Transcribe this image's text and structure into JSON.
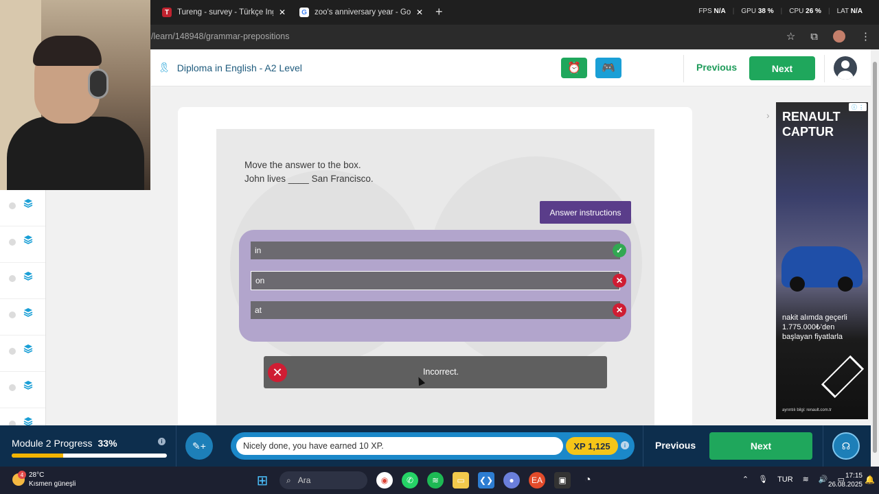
{
  "browser": {
    "tabs": [
      {
        "title": "Tureng - survey - Türkçe İngilizce",
        "favicon": "T",
        "favicon_color": "#c0232f"
      },
      {
        "title": "zoo's anniversary year - Google",
        "favicon": "G",
        "favicon_color": "#4285f4"
      }
    ],
    "url": "/learn/148948/grammar-prepositions",
    "stats": {
      "fps_label": "FPS",
      "fps": "N/A",
      "gpu_label": "GPU",
      "gpu": "38 %",
      "cpu_label": "CPU",
      "cpu": "26 %",
      "lat_label": "LAT",
      "lat": "N/A"
    }
  },
  "header": {
    "course_title": "Diploma in English - A2 Level",
    "previous_label": "Previous",
    "next_label": "Next",
    "accent": "#1fa75c",
    "alarm_color": "#1fa75c",
    "game_color": "#1a9fd6"
  },
  "exercise": {
    "instruction": "Move the answer to the box.",
    "sentence": "John lives ____ San Francisco.",
    "answer_instructions_label": "Answer instructions",
    "options": [
      {
        "label": "in",
        "status": "correct",
        "selected": false
      },
      {
        "label": "on",
        "status": "incorrect",
        "selected": true
      },
      {
        "label": "at",
        "status": "incorrect",
        "selected": false
      }
    ],
    "feedback": "Incorrect."
  },
  "ad": {
    "brand_line1": "RENAULT",
    "brand_line2": "CAPTUR",
    "text_line1": "nakit alımda geçerli",
    "text_line2": "1.775.000₺'den",
    "text_line3": "başlayan fiyatlarla",
    "footer": "ayrıntılı bilgi: renault.com.tr"
  },
  "bottom": {
    "module_title": "Module 2 Progress",
    "module_percent": "33%",
    "module_progress": 0.33,
    "xp_message": "Nicely done, you have earned 10 XP.",
    "xp_total": "XP 1,125",
    "previous_label": "Previous",
    "next_label": "Next"
  },
  "taskbar": {
    "temperature": "28°C",
    "weather": "Kısmen güneşli",
    "weather_badge": "4",
    "search_placeholder": "Ara",
    "language": "TUR",
    "time": "17:15",
    "date": "26.08.2025"
  }
}
